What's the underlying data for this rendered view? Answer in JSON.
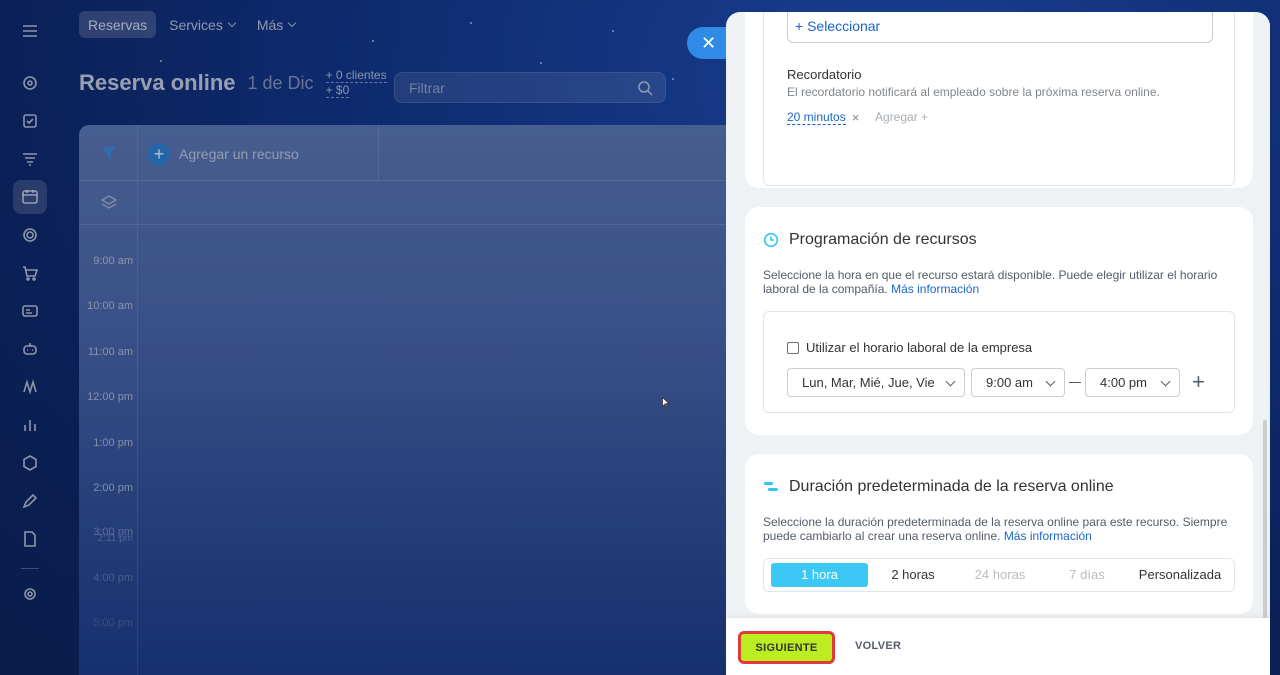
{
  "topnav": {
    "tabs": [
      {
        "label": "Reservas",
        "active": true
      },
      {
        "label": "Services",
        "dropdown": true
      },
      {
        "label": "Más",
        "dropdown": true
      }
    ]
  },
  "header": {
    "title": "Reserva online",
    "date": "1 de Dic",
    "clients": "+ 0 clientes",
    "amount": "+ $0",
    "filter_placeholder": "Filtrar"
  },
  "calendar": {
    "add_resource": "Agregar un recurso",
    "hours": [
      "9:00 am",
      "10:00 am",
      "11:00 am",
      "12:00 pm",
      "1:00 pm",
      "2:00 pm",
      "3:00 pm",
      "4:00 pm",
      "5:00 pm"
    ],
    "now_marker": "2:11 pm"
  },
  "panel": {
    "select_link": "+ Seleccionar",
    "reminder": {
      "title": "Recordatorio",
      "description": "El recordatorio notificará al empleado sobre la próxima reserva online.",
      "value": "20 minutos",
      "add": "Agregar +"
    },
    "schedule": {
      "title": "Programación de recursos",
      "description": "Seleccione la hora en que el recurso estará disponible. Puede elegir utilizar el horario laboral de la compañía.",
      "more_info": "Más información",
      "checkbox_label": "Utilizar el horario laboral de la empresa",
      "days": "Lun, Mar, Mié, Jue, Vie",
      "from": "9:00 am",
      "to": "4:00 pm"
    },
    "duration": {
      "title": "Duración predeterminada de la reserva online",
      "description": "Seleccione la duración predeterminada de la reserva online para este recurso. Siempre puede cambiarlo al crear una reserva online.",
      "more_info": "Más información",
      "options": [
        "1 hora",
        "2 horas",
        "24 horas",
        "7 días",
        "Personalizada"
      ],
      "selected": "1 hora"
    },
    "footer": {
      "next": "SIGUIENTE",
      "back": "VOLVER"
    }
  },
  "colors": {
    "accent_blue": "#1a66c8",
    "next_button": "#bbed21",
    "highlight_border": "#e03a3a",
    "segment_selected": "#3bc8f5"
  }
}
